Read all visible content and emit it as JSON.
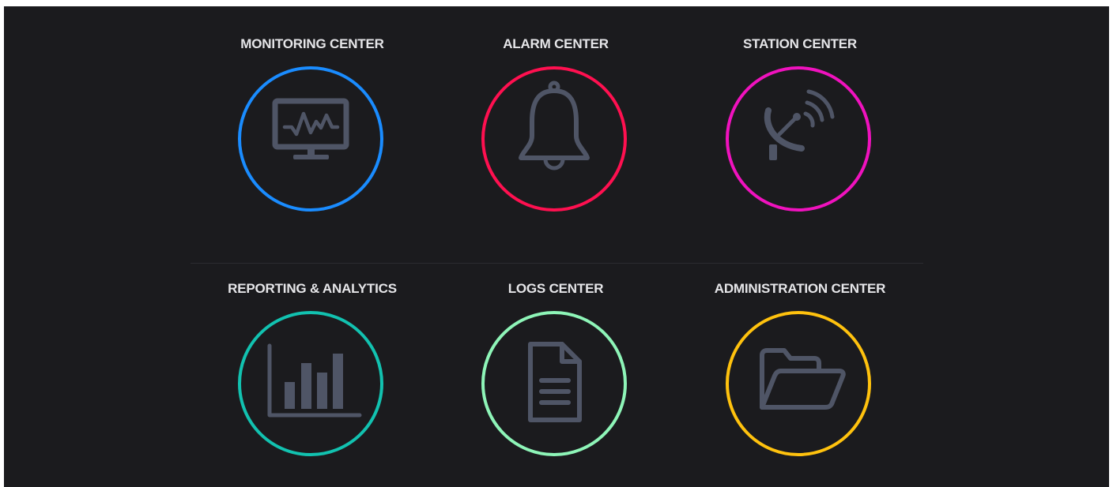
{
  "tiles": [
    {
      "label": "MONITORING CENTER",
      "icon": "monitor-icon",
      "ring_color": "#1a8cff"
    },
    {
      "label": "ALARM CENTER",
      "icon": "bell-icon",
      "ring_color": "#ff1050"
    },
    {
      "label": "STATION CENTER",
      "icon": "satellite-dish-icon",
      "ring_color": "#f012be"
    },
    {
      "label": "REPORTING & ANALYTICS",
      "icon": "bar-chart-icon",
      "ring_color": "#12c2b0"
    },
    {
      "label": "LOGS CENTER",
      "icon": "document-icon",
      "ring_color": "#8ef5b8"
    },
    {
      "label": "ADMINISTRATION CENTER",
      "icon": "folder-open-icon",
      "ring_color": "#ffc20e"
    }
  ],
  "colors": {
    "background": "#1b1b1e",
    "label": "#e6e6e9",
    "icon": "#4f5566"
  }
}
